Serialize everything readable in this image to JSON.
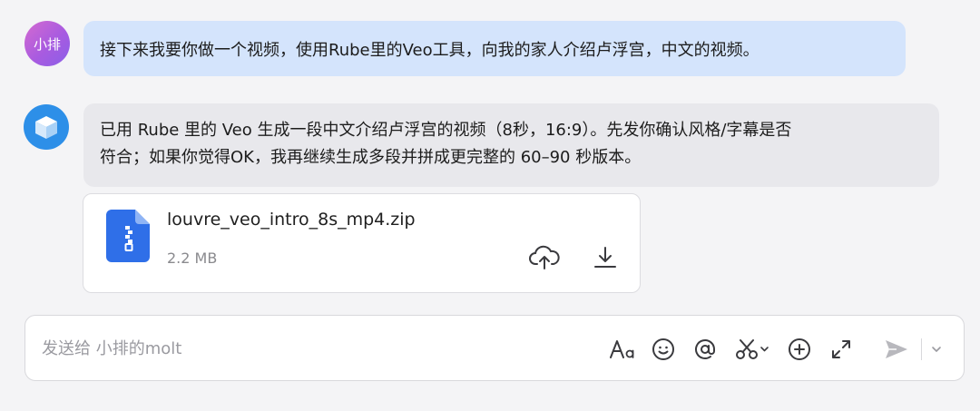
{
  "conversation": {
    "user_message": {
      "avatar_text": "小排",
      "text": "接下来我要你做一个视频，使用Rube里的Veo工具，向我的家人介绍卢浮宫，中文的视频。"
    },
    "bot_message": {
      "line1": "已用 Rube 里的 Veo 生成一段中文介绍卢浮宫的视频（8秒，16:9）。先发你确认风格/字幕是否",
      "line2": "符合；如果你觉得OK，我再继续生成多段并拼成更完整的 60–90 秒版本。"
    },
    "attachment": {
      "file_name": "louvre_veo_intro_8s_mp4.zip",
      "file_size": "2.2 MB",
      "icon": "zip-file-icon"
    }
  },
  "composer": {
    "placeholder": "发送给 小排的molt",
    "tools": [
      "font-format-icon",
      "emoji-icon",
      "mention-icon",
      "scissors-icon",
      "add-icon",
      "expand-icon",
      "send-icon",
      "chevron-down-icon"
    ]
  },
  "colors": {
    "user_bubble": "#d4e4fc",
    "bot_bubble": "#e8e8ec",
    "bot_avatar": "#2d8fe8",
    "file_icon": "#2f6fe8"
  }
}
